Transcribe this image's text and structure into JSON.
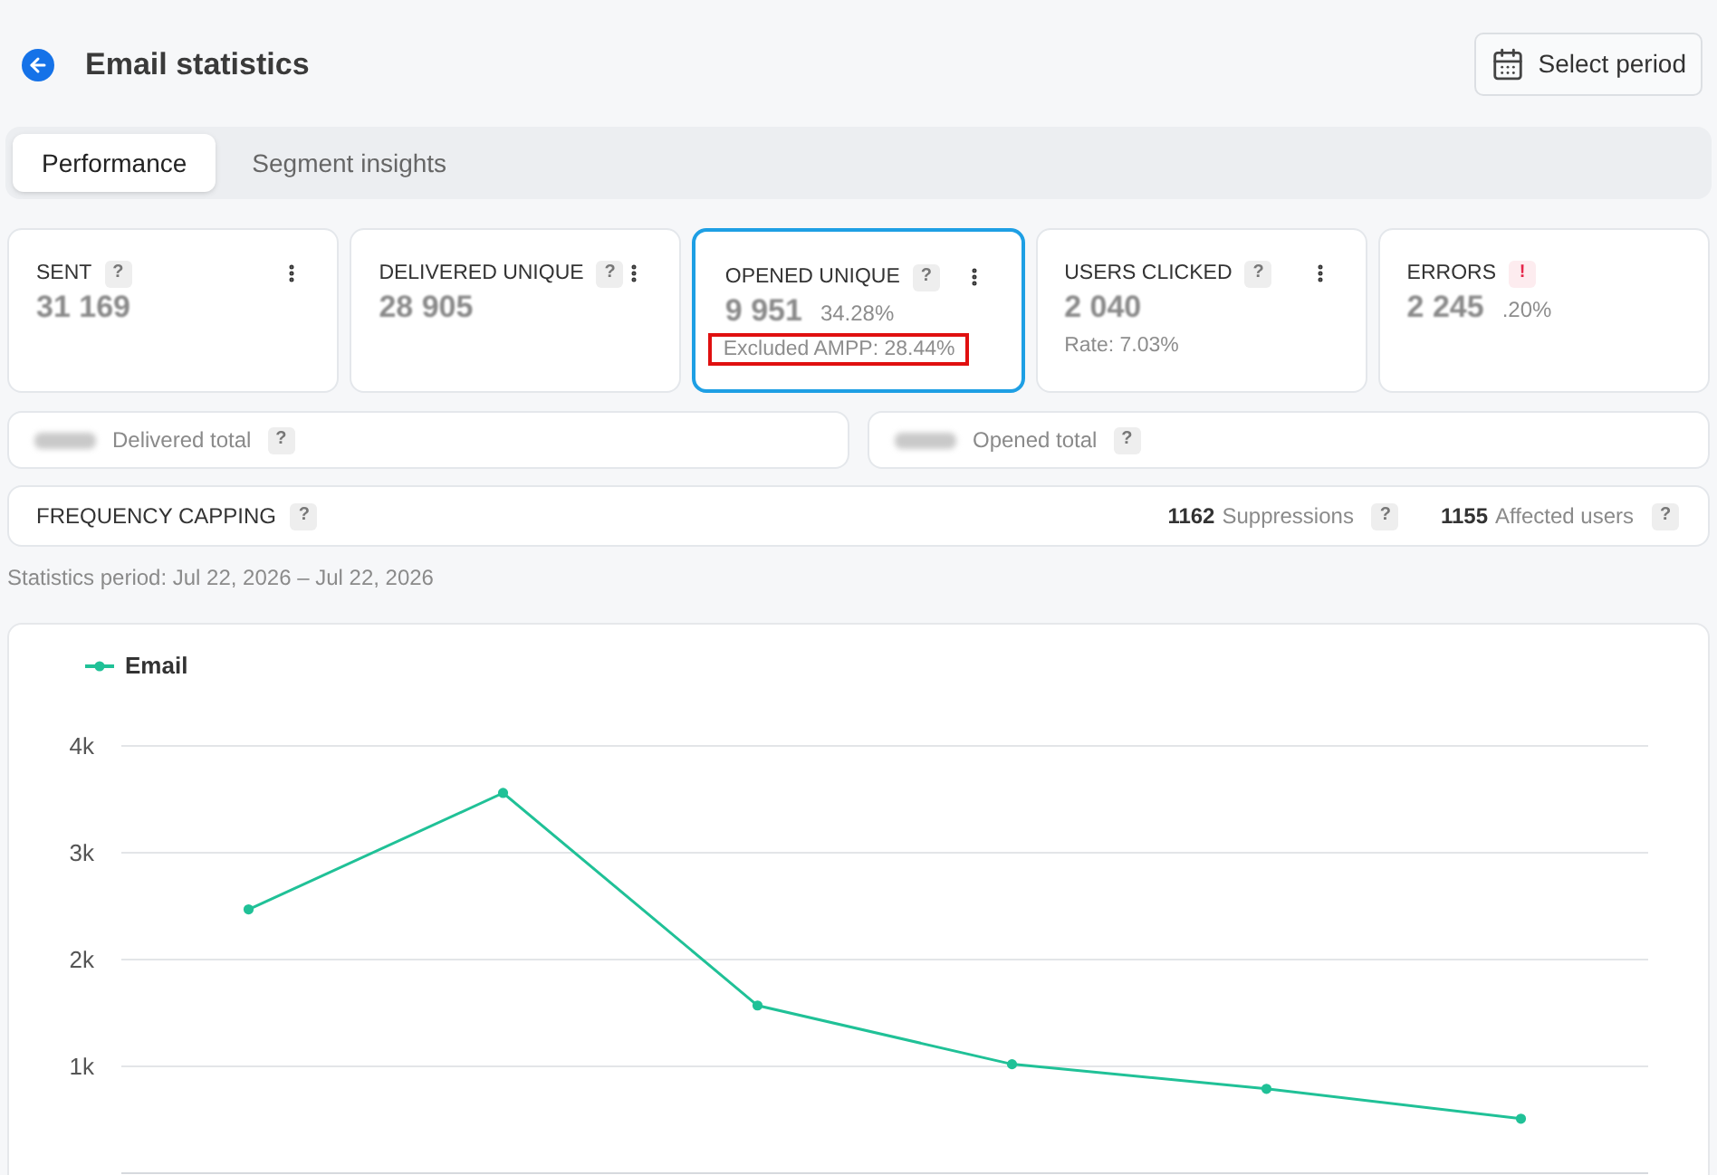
{
  "header": {
    "title": "Email statistics",
    "button": "Select period"
  },
  "tabs": [
    {
      "label": "Performance",
      "selected": true
    },
    {
      "label": "Segment insights",
      "selected": false
    }
  ],
  "metrics": [
    {
      "label": "SENT",
      "badge": {
        "kind": "help",
        "text": "?"
      },
      "menu": true,
      "selected": false,
      "value": "31 169"
    },
    {
      "label": "DELIVERED UNIQUE",
      "badge": {
        "kind": "help",
        "text": "?"
      },
      "menu": true,
      "selected": false,
      "value": "28 905"
    },
    {
      "label": "OPENED UNIQUE",
      "badge": {
        "kind": "help",
        "text": "?"
      },
      "menu": true,
      "selected": true,
      "value": "9 951",
      "secondary": "34.28%",
      "note": {
        "text": "Excluded AMPP: 28.44%",
        "highlighted": true
      }
    },
    {
      "label": "USERS CLICKED",
      "badge": {
        "kind": "help",
        "text": "?"
      },
      "menu": true,
      "selected": false,
      "value": "2 040",
      "note": {
        "text": "Rate: 7.03%",
        "highlighted": false
      }
    },
    {
      "label": "ERRORS",
      "badge": {
        "kind": "error",
        "text": "!"
      },
      "menu": false,
      "selected": false,
      "value": "2 245",
      "secondary": ".20%"
    }
  ],
  "totals": [
    {
      "label": "Delivered total",
      "badge": {
        "kind": "help",
        "text": "?"
      }
    },
    {
      "label": "Opened total",
      "badge": {
        "kind": "help",
        "text": "?"
      }
    }
  ],
  "frequency_capping": {
    "title": "FREQUENCY CAPPING",
    "badge": {
      "kind": "help",
      "text": "?"
    },
    "stats": [
      {
        "value": "1162",
        "label": "Suppressions",
        "badge": {
          "kind": "help",
          "text": "?"
        }
      },
      {
        "value": "1155",
        "label": "Affected users",
        "badge": {
          "kind": "help",
          "text": "?"
        }
      }
    ]
  },
  "statistics_period": "Statistics period: Jul 22, 2026 – Jul 22, 2026",
  "chart": {
    "chart_data": {
      "type": "line",
      "categories": [
        null,
        null,
        null,
        null,
        null,
        null
      ],
      "ylim": [
        0,
        4000
      ],
      "grid": true,
      "series": [
        {
          "name": "Email",
          "color": "#20c197",
          "marker": "circle",
          "values": [
            2470,
            3560,
            1570,
            1020,
            790,
            510
          ]
        }
      ],
      "yticks": [
        {
          "value": 1000,
          "label": "1k"
        },
        {
          "value": 2000,
          "label": "2k"
        },
        {
          "value": 3000,
          "label": "3k"
        },
        {
          "value": 4000,
          "label": "4k"
        }
      ]
    }
  }
}
